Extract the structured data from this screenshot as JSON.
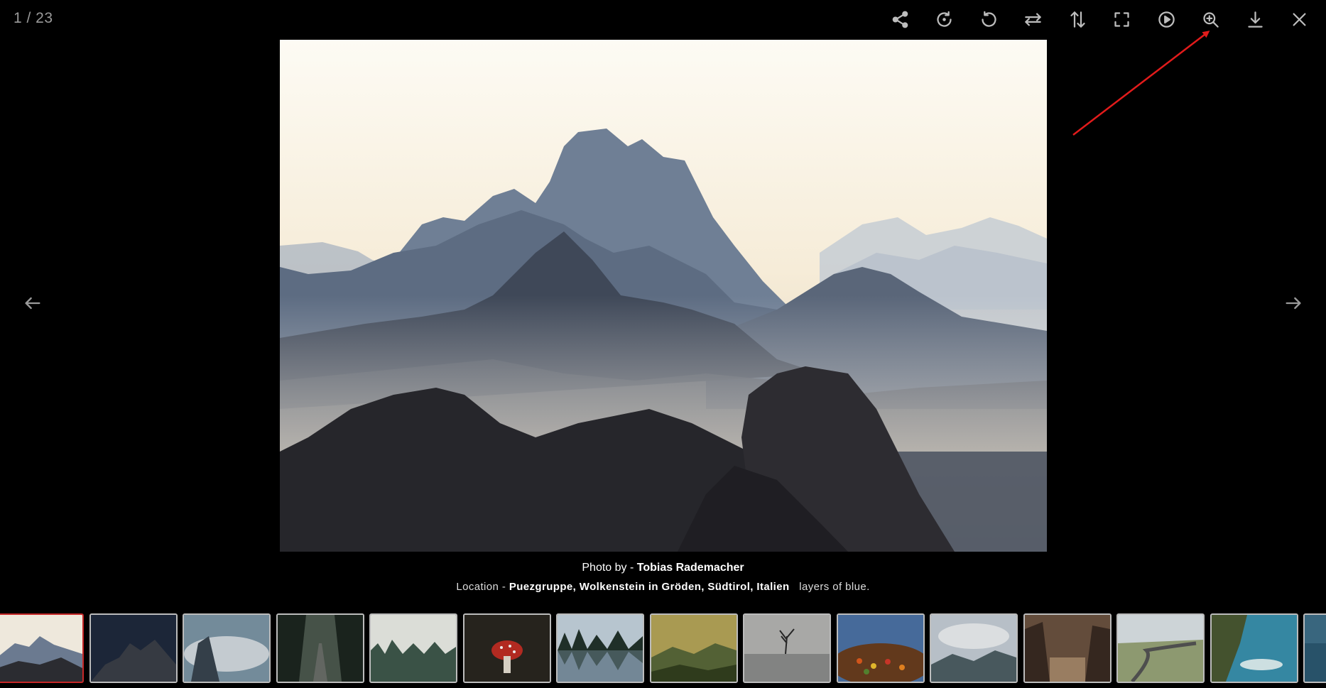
{
  "viewer": {
    "counter": "1 / 23"
  },
  "toolbar": {
    "buttons": [
      {
        "name": "share",
        "icon": "share-icon"
      },
      {
        "name": "rotate-right",
        "icon": "rotate-right-icon"
      },
      {
        "name": "rotate-left",
        "icon": "rotate-left-icon"
      },
      {
        "name": "flip-horizontal",
        "icon": "flip-horizontal-icon"
      },
      {
        "name": "flip-vertical",
        "icon": "flip-vertical-icon"
      },
      {
        "name": "fullscreen",
        "icon": "fullscreen-icon"
      },
      {
        "name": "slideshow",
        "icon": "play-icon"
      },
      {
        "name": "zoom-in",
        "icon": "zoom-in-icon"
      },
      {
        "name": "download",
        "icon": "download-icon"
      },
      {
        "name": "close",
        "icon": "close-icon"
      }
    ]
  },
  "caption": {
    "photo_by_prefix": "Photo by - ",
    "photographer": "Tobias Rademacher",
    "location_prefix": "Location - ",
    "location": "Puezgruppe, Wolkenstein in Gröden, Südtirol, Italien",
    "description": "layers of blue."
  },
  "thumbnails": {
    "active_index": 0,
    "items": [
      {
        "scene": "misty-mountains"
      },
      {
        "scene": "night-peaks"
      },
      {
        "scene": "cloudy-cliffs"
      },
      {
        "scene": "forest-road"
      },
      {
        "scene": "foggy-pines"
      },
      {
        "scene": "red-mushroom"
      },
      {
        "scene": "lake-reflection"
      },
      {
        "scene": "golden-valley"
      },
      {
        "scene": "lone-tree-lake"
      },
      {
        "scene": "flower-field"
      },
      {
        "scene": "cloudy-valley"
      },
      {
        "scene": "sea-cliffs-sunset"
      },
      {
        "scene": "winding-road"
      },
      {
        "scene": "coastal-cliffs"
      },
      {
        "scene": "ocean"
      }
    ]
  },
  "colors": {
    "background": "#000000",
    "active_thumb_border": "#c62828",
    "annotation_arrow": "#e21b1b"
  }
}
